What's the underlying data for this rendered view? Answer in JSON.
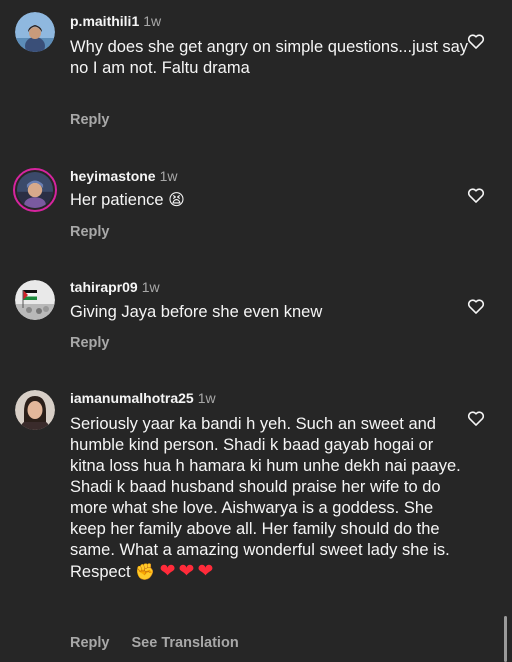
{
  "comments": [
    {
      "username": "p.maithili1",
      "time": "1w",
      "text": "Why does she get angry on simple questions...just say no I am not. Faltu drama",
      "actions": {
        "reply": "Reply"
      }
    },
    {
      "username": "heyimastone",
      "time": "1w",
      "text": "Her patience",
      "emoji": "😫",
      "actions": {
        "reply": "Reply"
      }
    },
    {
      "username": "tahirapr09",
      "time": "1w",
      "text": "Giving Jaya before she even knew",
      "actions": {
        "reply": "Reply"
      }
    },
    {
      "username": "iamanumalhotra25",
      "time": "1w",
      "text": "Seriously yaar ka bandi h yeh. Such an sweet and humble kind person. Shadi k baad gayab hogai or kitna loss hua h hamara ki hum unhe dekh nai paaye. Shadi k baad husband should praise her wife to do more what she love. Aishwarya is a goddess. She keep her family above all. Her family should do the same. What a amazing wonderful sweet lady she is. Respect",
      "emoji_fist": "✊",
      "emoji_hearts": "❤❤❤",
      "actions": {
        "reply": "Reply",
        "translate": "See Translation"
      }
    }
  ],
  "icons": {
    "like": "heart-outline-icon"
  },
  "colors": {
    "background": "#262626",
    "primary_text": "#f5f5f5",
    "secondary_text": "#a8a8a8",
    "story_ring": "#d6249f"
  }
}
